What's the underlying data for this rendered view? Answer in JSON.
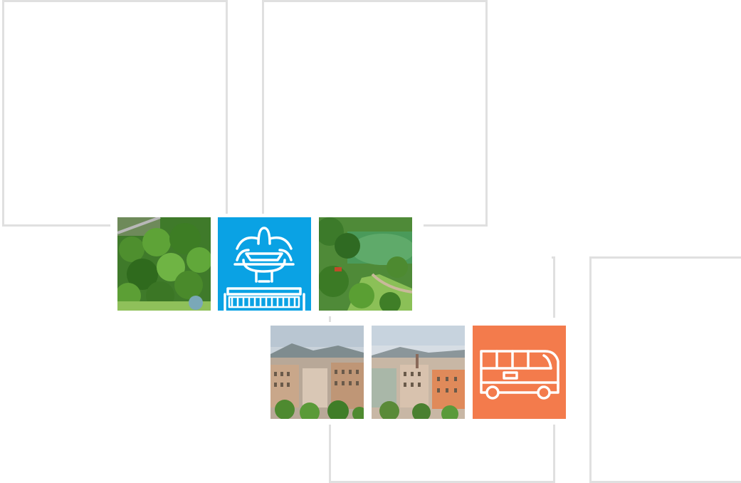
{
  "colors": {
    "frame": "#e0e0e0",
    "fountain_tile": "#0aa2e4",
    "bus_tile": "#f37b4c",
    "icon_stroke": "#ffffff"
  },
  "tiles": [
    {
      "kind": "photo",
      "icon": "park-aerial-photo"
    },
    {
      "kind": "icon",
      "icon": "fountain-icon"
    },
    {
      "kind": "photo",
      "icon": "lake-park-photo"
    },
    {
      "kind": "photo",
      "icon": "city-skyline-photo"
    },
    {
      "kind": "photo",
      "icon": "city-buildings-photo"
    },
    {
      "kind": "icon",
      "icon": "bus-icon"
    }
  ]
}
